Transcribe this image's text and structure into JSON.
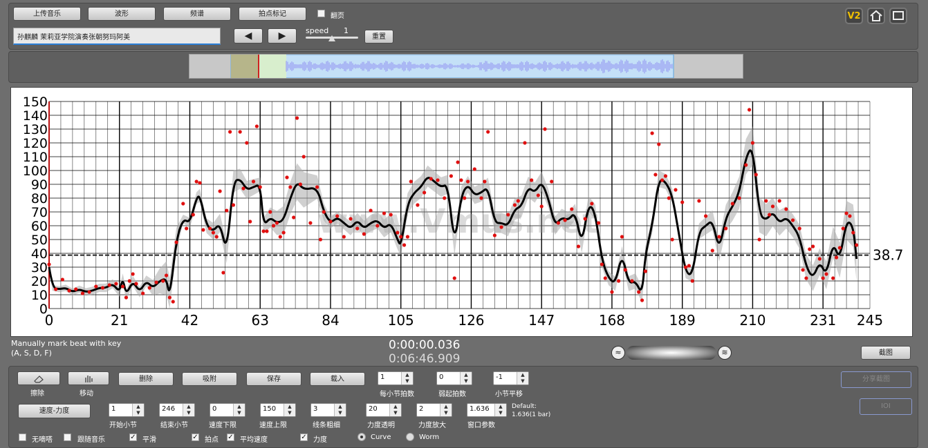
{
  "toolbar": {
    "upload": "上传音乐",
    "waveform": "波形",
    "spectrum": "频谱",
    "beat_mark": "拍点标记",
    "page_flip": "翻页",
    "song_title": "孙麒麟 茉莉亚学院演奏张朝努玛阿美",
    "speed_label": "speed",
    "speed_value": "1",
    "speed_fraction": 0.5,
    "reset": "重置",
    "badge": "V2"
  },
  "colors": {
    "accent": "#e6b800",
    "curve": "#000000",
    "points": "#e01010",
    "band": "#aaaaaa"
  },
  "chart_data": {
    "type": "line",
    "x_ticks": [
      0,
      21,
      42,
      63,
      84,
      105,
      126,
      147,
      168,
      189,
      210,
      231,
      245
    ],
    "y_ticks": [
      0,
      10,
      20,
      30,
      40,
      50,
      60,
      70,
      80,
      90,
      100,
      110,
      120,
      130,
      140,
      150
    ],
    "xlim": [
      0,
      245
    ],
    "ylim": [
      0,
      150
    ],
    "average": 38.7,
    "average_label": "38.7",
    "watermark": "www.Vmus.net",
    "curve": [
      [
        0,
        30
      ],
      [
        1,
        15
      ],
      [
        3,
        14
      ],
      [
        5,
        15
      ],
      [
        7,
        12
      ],
      [
        9,
        14
      ],
      [
        11,
        12
      ],
      [
        13,
        13
      ],
      [
        15,
        15
      ],
      [
        17,
        15
      ],
      [
        19,
        18
      ],
      [
        21,
        12
      ],
      [
        22,
        22
      ],
      [
        23,
        10
      ],
      [
        25,
        20
      ],
      [
        27,
        12
      ],
      [
        29,
        20
      ],
      [
        31,
        15
      ],
      [
        33,
        20
      ],
      [
        35,
        22
      ],
      [
        36,
        8
      ],
      [
        38,
        50
      ],
      [
        40,
        65
      ],
      [
        42,
        62
      ],
      [
        44,
        80
      ],
      [
        45,
        82
      ],
      [
        47,
        60
      ],
      [
        49,
        56
      ],
      [
        51,
        62
      ],
      [
        53,
        40
      ],
      [
        55,
        92
      ],
      [
        57,
        94
      ],
      [
        59,
        86
      ],
      [
        61,
        88
      ],
      [
        63,
        90
      ],
      [
        64,
        60
      ],
      [
        66,
        66
      ],
      [
        68,
        62
      ],
      [
        70,
        64
      ],
      [
        72,
        80
      ],
      [
        74,
        92
      ],
      [
        76,
        86
      ],
      [
        80,
        88
      ],
      [
        82,
        70
      ],
      [
        84,
        62
      ],
      [
        86,
        66
      ],
      [
        88,
        62
      ],
      [
        90,
        58
      ],
      [
        92,
        64
      ],
      [
        94,
        58
      ],
      [
        96,
        62
      ],
      [
        98,
        64
      ],
      [
        100,
        58
      ],
      [
        102,
        62
      ],
      [
        104,
        50
      ],
      [
        105,
        45
      ],
      [
        107,
        76
      ],
      [
        109,
        84
      ],
      [
        111,
        88
      ],
      [
        113,
        96
      ],
      [
        115,
        92
      ],
      [
        117,
        88
      ],
      [
        119,
        90
      ],
      [
        121,
        45
      ],
      [
        123,
        82
      ],
      [
        125,
        90
      ],
      [
        127,
        82
      ],
      [
        129,
        84
      ],
      [
        131,
        88
      ],
      [
        133,
        62
      ],
      [
        135,
        62
      ],
      [
        137,
        60
      ],
      [
        139,
        72
      ],
      [
        141,
        74
      ],
      [
        143,
        88
      ],
      [
        145,
        84
      ],
      [
        147,
        92
      ],
      [
        149,
        80
      ],
      [
        151,
        60
      ],
      [
        153,
        66
      ],
      [
        155,
        64
      ],
      [
        157,
        70
      ],
      [
        159,
        46
      ],
      [
        161,
        76
      ],
      [
        163,
        70
      ],
      [
        165,
        35
      ],
      [
        167,
        22
      ],
      [
        169,
        18
      ],
      [
        171,
        40
      ],
      [
        173,
        18
      ],
      [
        175,
        20
      ],
      [
        177,
        10
      ],
      [
        178,
        40
      ],
      [
        180,
        60
      ],
      [
        182,
        94
      ],
      [
        184,
        92
      ],
      [
        186,
        82
      ],
      [
        188,
        54
      ],
      [
        190,
        26
      ],
      [
        192,
        24
      ],
      [
        194,
        56
      ],
      [
        196,
        60
      ],
      [
        198,
        64
      ],
      [
        200,
        42
      ],
      [
        202,
        66
      ],
      [
        204,
        74
      ],
      [
        206,
        84
      ],
      [
        208,
        110
      ],
      [
        210,
        118
      ],
      [
        212,
        68
      ],
      [
        214,
        64
      ],
      [
        216,
        70
      ],
      [
        218,
        62
      ],
      [
        220,
        66
      ],
      [
        222,
        60
      ],
      [
        224,
        52
      ],
      [
        226,
        30
      ],
      [
        228,
        22
      ],
      [
        230,
        34
      ],
      [
        232,
        24
      ],
      [
        234,
        48
      ],
      [
        236,
        35
      ],
      [
        238,
        64
      ],
      [
        240,
        60
      ],
      [
        241,
        36
      ]
    ],
    "band_half_width": [
      [
        0,
        2
      ],
      [
        30,
        4
      ],
      [
        36,
        14
      ],
      [
        40,
        3
      ],
      [
        55,
        8
      ],
      [
        63,
        5
      ],
      [
        75,
        14
      ],
      [
        84,
        4
      ],
      [
        110,
        8
      ],
      [
        125,
        6
      ],
      [
        140,
        8
      ],
      [
        155,
        6
      ],
      [
        168,
        5
      ],
      [
        182,
        6
      ],
      [
        190,
        4
      ],
      [
        200,
        8
      ],
      [
        210,
        14
      ],
      [
        220,
        8
      ],
      [
        232,
        10
      ],
      [
        241,
        16
      ]
    ],
    "points": [
      [
        0,
        32
      ],
      [
        2,
        14
      ],
      [
        4,
        21
      ],
      [
        6,
        13
      ],
      [
        8,
        14
      ],
      [
        10,
        11
      ],
      [
        12,
        12
      ],
      [
        14,
        16
      ],
      [
        16,
        15
      ],
      [
        18,
        17
      ],
      [
        20,
        18
      ],
      [
        22,
        16
      ],
      [
        23,
        8
      ],
      [
        24,
        20
      ],
      [
        25,
        25
      ],
      [
        26,
        18
      ],
      [
        28,
        11
      ],
      [
        30,
        15
      ],
      [
        32,
        19
      ],
      [
        34,
        20
      ],
      [
        35,
        24
      ],
      [
        36,
        8
      ],
      [
        37,
        5
      ],
      [
        38,
        48
      ],
      [
        40,
        76
      ],
      [
        41,
        58
      ],
      [
        43,
        68
      ],
      [
        44,
        92
      ],
      [
        45,
        91
      ],
      [
        46,
        57
      ],
      [
        48,
        58
      ],
      [
        49,
        55
      ],
      [
        50,
        52
      ],
      [
        51,
        85
      ],
      [
        52,
        26
      ],
      [
        53,
        71
      ],
      [
        54,
        128
      ],
      [
        55,
        75
      ],
      [
        57,
        128
      ],
      [
        58,
        87
      ],
      [
        59,
        120
      ],
      [
        60,
        63
      ],
      [
        61,
        92
      ],
      [
        62,
        132
      ],
      [
        63,
        88
      ],
      [
        64,
        56
      ],
      [
        65,
        56
      ],
      [
        66,
        70
      ],
      [
        67,
        60
      ],
      [
        68,
        62
      ],
      [
        69,
        52
      ],
      [
        70,
        55
      ],
      [
        71,
        95
      ],
      [
        72,
        88
      ],
      [
        73,
        66
      ],
      [
        74,
        138
      ],
      [
        75,
        90
      ],
      [
        76,
        110
      ],
      [
        78,
        62
      ],
      [
        80,
        88
      ],
      [
        81,
        50
      ],
      [
        82,
        70
      ],
      [
        84,
        63
      ],
      [
        86,
        67
      ],
      [
        88,
        52
      ],
      [
        90,
        65
      ],
      [
        92,
        58
      ],
      [
        94,
        54
      ],
      [
        96,
        71
      ],
      [
        98,
        60
      ],
      [
        100,
        69
      ],
      [
        102,
        68
      ],
      [
        104,
        55
      ],
      [
        105,
        52
      ],
      [
        106,
        46
      ],
      [
        107,
        52
      ],
      [
        108,
        92
      ],
      [
        110,
        75
      ],
      [
        112,
        84
      ],
      [
        114,
        94
      ],
      [
        116,
        93
      ],
      [
        118,
        80
      ],
      [
        120,
        96
      ],
      [
        121,
        22
      ],
      [
        122,
        106
      ],
      [
        123,
        93
      ],
      [
        124,
        80
      ],
      [
        125,
        92
      ],
      [
        127,
        101
      ],
      [
        129,
        80
      ],
      [
        130,
        92
      ],
      [
        131,
        128
      ],
      [
        133,
        53
      ],
      [
        135,
        59
      ],
      [
        137,
        68
      ],
      [
        139,
        75
      ],
      [
        140,
        78
      ],
      [
        142,
        120
      ],
      [
        144,
        93
      ],
      [
        146,
        82
      ],
      [
        147,
        74
      ],
      [
        148,
        130
      ],
      [
        150,
        92
      ],
      [
        152,
        62
      ],
      [
        154,
        64
      ],
      [
        156,
        72
      ],
      [
        158,
        45
      ],
      [
        160,
        65
      ],
      [
        162,
        76
      ],
      [
        164,
        62
      ],
      [
        165,
        32
      ],
      [
        166,
        22
      ],
      [
        168,
        12
      ],
      [
        170,
        20
      ],
      [
        171,
        52
      ],
      [
        172,
        28
      ],
      [
        174,
        20
      ],
      [
        176,
        12
      ],
      [
        177,
        6
      ],
      [
        178,
        27
      ],
      [
        180,
        127
      ],
      [
        181,
        97
      ],
      [
        182,
        119
      ],
      [
        183,
        93
      ],
      [
        184,
        96
      ],
      [
        185,
        80
      ],
      [
        186,
        50
      ],
      [
        187,
        86
      ],
      [
        189,
        77
      ],
      [
        190,
        30
      ],
      [
        191,
        31
      ],
      [
        192,
        20
      ],
      [
        194,
        78
      ],
      [
        196,
        67
      ],
      [
        198,
        42
      ],
      [
        200,
        52
      ],
      [
        202,
        58
      ],
      [
        204,
        76
      ],
      [
        206,
        80
      ],
      [
        208,
        104
      ],
      [
        209,
        144
      ],
      [
        210,
        120
      ],
      [
        211,
        97
      ],
      [
        212,
        50
      ],
      [
        214,
        78
      ],
      [
        215,
        68
      ],
      [
        216,
        74
      ],
      [
        218,
        78
      ],
      [
        220,
        72
      ],
      [
        222,
        64
      ],
      [
        224,
        58
      ],
      [
        225,
        28
      ],
      [
        226,
        22
      ],
      [
        227,
        43
      ],
      [
        228,
        45
      ],
      [
        230,
        36
      ],
      [
        231,
        22
      ],
      [
        232,
        25
      ],
      [
        234,
        22
      ],
      [
        235,
        37
      ],
      [
        236,
        44
      ],
      [
        237,
        58
      ],
      [
        238,
        69
      ],
      [
        239,
        67
      ],
      [
        240,
        55
      ],
      [
        241,
        46
      ]
    ]
  },
  "overview": {
    "selection_start_fraction": 0.0,
    "selection_end_fraction": 0.24
  },
  "status": {
    "hint_line1": "Manually mark beat with key",
    "hint_line2": "(A, S, D, F)",
    "time_current": "0:00:00.036",
    "time_total": "0:06:46.909",
    "screenshot": "截图"
  },
  "controls": {
    "eraser": "擦除",
    "move": "移动",
    "delete": "删除",
    "snap": "吸附",
    "save": "保存",
    "load": "载入",
    "beats_per_bar_value": "1",
    "beats_per_bar": "每小节拍数",
    "weak_beat_value": "0",
    "weak_beat": "弱起拍数",
    "bar_shift_value": "-1",
    "bar_shift": "小节平移",
    "tempo_dynamics": "速度-力度",
    "start_bar_value": "1",
    "start_bar": "开始小节",
    "end_bar_value": "246",
    "end_bar": "结束小节",
    "tempo_min_value": "0",
    "tempo_min": "速度下限",
    "tempo_max_value": "150",
    "tempo_max": "速度上限",
    "line_width_value": "3",
    "line_width": "线条粗细",
    "opacity_value": "20",
    "opacity": "力度透明",
    "dyn_scale_value": "2",
    "dyn_scale": "力度放大",
    "window_value": "1.636",
    "window": "窗口参数",
    "default_line1": "Default:",
    "default_line2": "1.636(1 bar)",
    "share": "分享截图",
    "ioi": "IOI",
    "no_metronome": "无嘀嗒",
    "follow_music": "跟随音乐",
    "smooth": "平滑",
    "beat_points": "拍点",
    "avg_tempo": "平均速度",
    "dynamics": "力度",
    "curve": "Curve",
    "worm": "Worm"
  }
}
